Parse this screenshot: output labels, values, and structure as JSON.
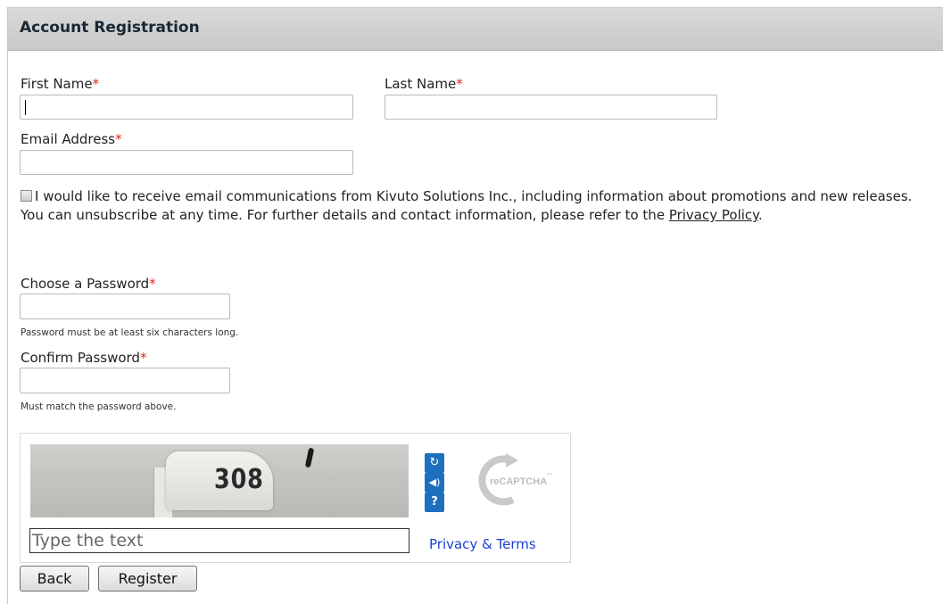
{
  "header": {
    "title": "Account Registration"
  },
  "form": {
    "required_marker": "*",
    "first_name": {
      "label": "First Name",
      "value": ""
    },
    "last_name": {
      "label": "Last Name",
      "value": ""
    },
    "email": {
      "label": "Email Address",
      "value": ""
    },
    "consent": {
      "checked": false,
      "text": "I would like to receive email communications from Kivuto Solutions Inc., including information about promotions and new releases.",
      "unsubscribe_text": "You can unsubscribe at any time. For further details and contact information, please refer to the ",
      "privacy_link": "Privacy Policy",
      "trailing": "."
    },
    "password": {
      "label": "Choose a Password",
      "hint": "Password must be at least six characters long."
    },
    "confirm_password": {
      "label": "Confirm Password",
      "hint": "Must match the password above."
    }
  },
  "captcha": {
    "image_text": "308",
    "placeholder": "Type the text",
    "privacy_terms": "Privacy & Terms",
    "logo_text": "reCAPTCHA",
    "logo_tm": "™",
    "icons": [
      "refresh-icon",
      "audio-icon",
      "help-icon"
    ]
  },
  "buttons": {
    "back": "Back",
    "register": "Register"
  },
  "colors": {
    "required": "#e0261b",
    "link": "#1a3fd6",
    "captcha_button": "#1f6fbf"
  }
}
